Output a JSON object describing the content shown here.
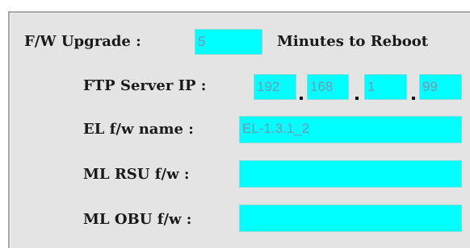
{
  "fw_upgrade": {
    "label": "F/W Upgrade :",
    "minutes_value": "5",
    "suffix": "Minutes to Reboot"
  },
  "ftp_server_ip": {
    "label": "FTP Server IP :",
    "octets": [
      "192",
      "168",
      "1",
      "99"
    ]
  },
  "el_fw_name": {
    "label": "EL f/w name :",
    "value": "EL-1.3.1_2"
  },
  "ml_rsu_fw": {
    "label": "ML RSU f/w :",
    "value": ""
  },
  "ml_obu_fw": {
    "label": "ML OBU f/w :",
    "value": ""
  },
  "colors": {
    "panel_bg": "#e4e4e4",
    "field_bg": "#00ffff",
    "field_text": "#6f9bb5"
  }
}
